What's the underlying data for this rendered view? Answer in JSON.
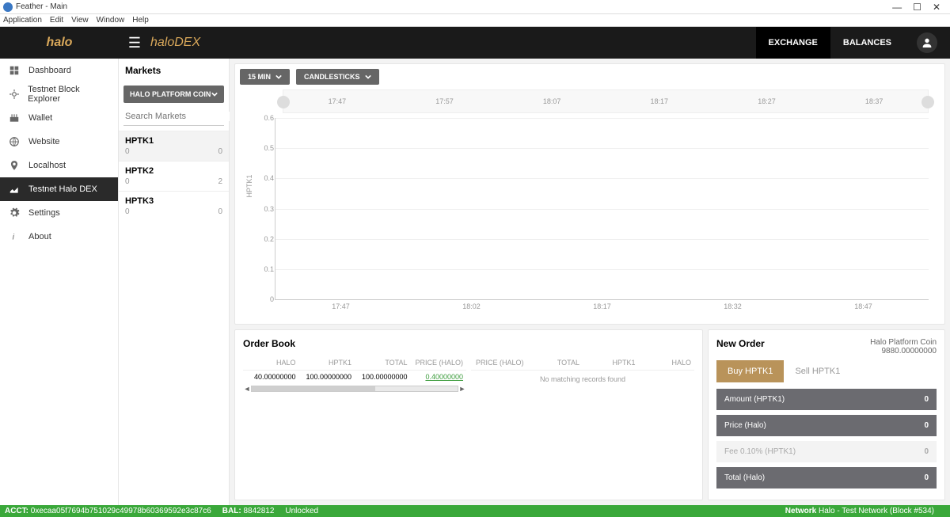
{
  "window": {
    "title": "Feather - Main"
  },
  "menubar": [
    "Application",
    "Edit",
    "View",
    "Window",
    "Help"
  ],
  "header": {
    "logo_left": "halo",
    "logo_right": "haloDEX",
    "nav": {
      "exchange": "EXCHANGE",
      "balances": "BALANCES"
    }
  },
  "sidebar": {
    "items": [
      {
        "label": "Dashboard",
        "icon": "dashboard"
      },
      {
        "label": "Testnet Block Explorer",
        "icon": "explorer"
      },
      {
        "label": "Wallet",
        "icon": "wallet"
      },
      {
        "label": "Website",
        "icon": "globe"
      },
      {
        "label": "Localhost",
        "icon": "pin"
      },
      {
        "label": "Testnet Halo DEX",
        "icon": "chart"
      },
      {
        "label": "Settings",
        "icon": "gear"
      },
      {
        "label": "About",
        "icon": "info"
      }
    ],
    "active": 5
  },
  "markets": {
    "title": "Markets",
    "dropdown": "HALO PLATFORM COIN",
    "search_placeholder": "Search Markets",
    "rows": [
      {
        "sym": "HPTK1",
        "l": "0",
        "r": "0"
      },
      {
        "sym": "HPTK2",
        "l": "0",
        "r": "2"
      },
      {
        "sym": "HPTK3",
        "l": "0",
        "r": "0"
      }
    ]
  },
  "chart": {
    "timeframe": "15 MIN",
    "style": "CANDLESTICKS",
    "ylabel": "HPTK1",
    "slider_ticks": [
      "17:47",
      "17:57",
      "18:07",
      "18:17",
      "18:27",
      "18:37"
    ],
    "yticks": [
      "0.6",
      "0.5",
      "0.4",
      "0.3",
      "0.2",
      "0.1",
      "0"
    ],
    "xticks": [
      "17:47",
      "18:02",
      "18:17",
      "18:32",
      "18:47"
    ]
  },
  "chart_data": {
    "type": "line",
    "title": "HPTK1",
    "xlabel": "",
    "ylabel": "HPTK1",
    "ylim": [
      0,
      0.6
    ],
    "x": [
      "17:47",
      "18:02",
      "18:17",
      "18:32",
      "18:47"
    ],
    "series": [
      {
        "name": "HPTK1",
        "values": [
          null,
          null,
          null,
          null,
          null
        ]
      }
    ]
  },
  "orderbook": {
    "title": "Order Book",
    "left_head": [
      "HALO",
      "HPTK1",
      "TOTAL",
      "PRICE (HALO)"
    ],
    "right_head": [
      "PRICE (HALO)",
      "TOTAL",
      "HPTK1",
      "HALO"
    ],
    "left_rows": [
      {
        "halo": "40.00000000",
        "hptk": "100.00000000",
        "total": "100.00000000",
        "price": "0.40000000"
      }
    ],
    "right_empty": "No matching records found"
  },
  "neworder": {
    "title": "New Order",
    "coin_name": "Halo Platform Coin",
    "coin_balance": "9880.00000000",
    "tab_buy": "Buy HPTK1",
    "tab_sell": "Sell HPTK1",
    "fields": {
      "amount_label": "Amount (HPTK1)",
      "amount_val": "0",
      "price_label": "Price (Halo)",
      "price_val": "0",
      "fee_label": "Fee 0.10% (HPTK1)",
      "fee_val": "0",
      "total_label": "Total (Halo)",
      "total_val": "0"
    }
  },
  "status": {
    "acct_label": "ACCT:",
    "acct": "0xecaa05f7694b751029c49978b60369592e3c87c6",
    "bal_label": "BAL:",
    "bal": "8842812",
    "lock": "Unlocked",
    "net_label": "Network",
    "net": "Halo - Test Network (Block #534)"
  }
}
